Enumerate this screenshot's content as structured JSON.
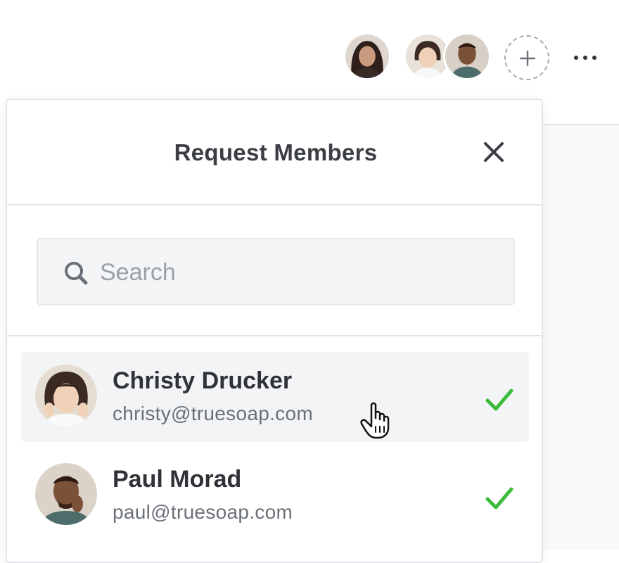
{
  "header": {
    "avatars": [
      {
        "name": "collaborator-1",
        "color": "#4a2f2a"
      },
      {
        "name": "collaborator-2",
        "color": "#d9b99b"
      },
      {
        "name": "collaborator-3",
        "color": "#6e4c38"
      }
    ],
    "add_icon": "plus-icon",
    "more_icon": "more-horizontal-icon"
  },
  "panel": {
    "title": "Request Members",
    "close_icon": "close-icon",
    "search": {
      "placeholder": "Search",
      "value": "",
      "icon": "search-icon"
    },
    "members": [
      {
        "name": "Christy Drucker",
        "email": "christy@truesoap.com",
        "selected": true,
        "hovered": true
      },
      {
        "name": "Paul Morad",
        "email": "paul@truesoap.com",
        "selected": true,
        "hovered": false
      }
    ]
  },
  "colors": {
    "check": "#3dbb3d",
    "hover_row": "#f3f4f6",
    "border": "#e3e5e9",
    "search_bg": "#f4f5f7"
  }
}
